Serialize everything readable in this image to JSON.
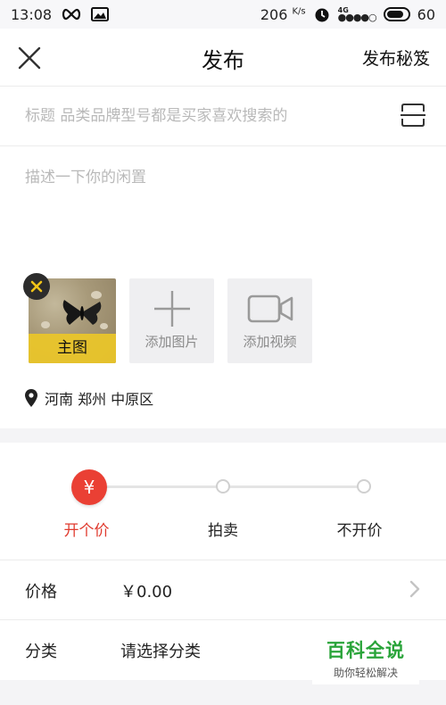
{
  "status_bar": {
    "time": "13:08",
    "speed": "206",
    "speed_unit": "K/s",
    "network": "4G",
    "battery": "60",
    "icons": [
      "infinity-icon",
      "image-icon",
      "alarm-icon",
      "signal-icon",
      "battery-icon"
    ]
  },
  "header": {
    "title": "发布",
    "action_label": "发布秘笈",
    "close_icon": "close-icon"
  },
  "title_field": {
    "placeholder": "标题 品类品牌型号都是买家喜欢搜索的",
    "value": ""
  },
  "description_field": {
    "placeholder": "描述一下你的闲置",
    "value": ""
  },
  "media": {
    "main_image_label": "主图",
    "add_photo_label": "添加图片",
    "add_video_label": "添加视频"
  },
  "location": {
    "text": "河南 郑州 中原区"
  },
  "price_mode": {
    "options": [
      "开个价",
      "拍卖",
      "不开价"
    ],
    "selected_index": 0,
    "selected_symbol": "¥"
  },
  "form": {
    "price_label": "价格",
    "price_value": "￥0.00",
    "category_label": "分类",
    "category_placeholder": "请选择分类"
  },
  "watermark": {
    "title": "百科全说",
    "subtitle": "助你轻松解决"
  },
  "colors": {
    "accent": "#ea4034",
    "badge_yellow": "#ebc728",
    "placeholder": "#b9b9b9",
    "tile_bg": "#efeff1",
    "watermark_green": "#2aa43a"
  }
}
